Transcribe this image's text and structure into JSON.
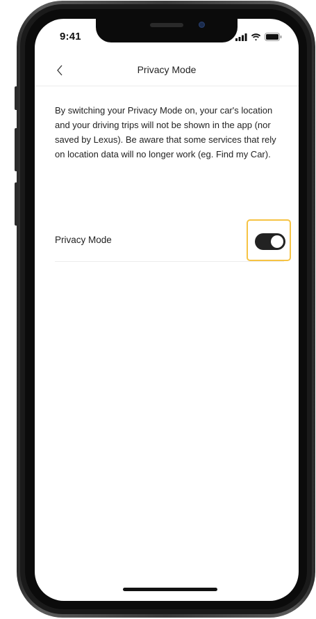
{
  "status_bar": {
    "time": "9:41",
    "icons": [
      "cellular-signal-icon",
      "wifi-icon",
      "battery-icon"
    ]
  },
  "nav": {
    "back_icon": "chevron-left-icon",
    "title": "Privacy Mode"
  },
  "content": {
    "description": "By switching your Privacy Mode on, your car's location and your driving trips will not be shown in the app (nor saved by Lexus). Be aware that some services that rely on location data will no longer work (eg. Find my Car).",
    "setting": {
      "label": "Privacy Mode",
      "toggle_state": "on"
    }
  },
  "colors": {
    "toggle_on": "#222222",
    "highlight": "#f6c343",
    "text": "#222222"
  }
}
